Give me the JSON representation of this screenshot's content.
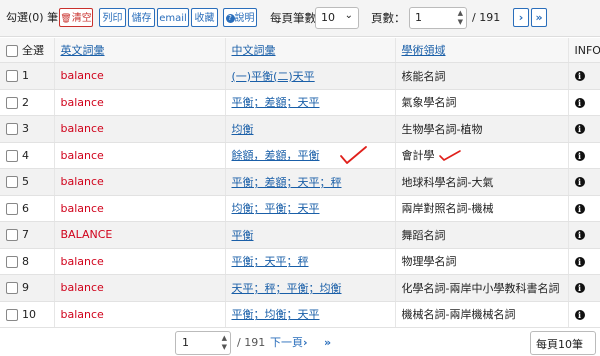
{
  "toolbar": {
    "selected_label": "勾選(",
    "selected_count": "0",
    "selected_suffix": ") 筆",
    "clear_label": "清空",
    "print_label": "列印",
    "save_label": "儲存",
    "email_label": "email",
    "collect_label": "收藏",
    "help_label": "說明",
    "per_page_label": "每頁筆數",
    "per_page_value": "10",
    "page_label": "頁數：",
    "page_value": "1",
    "page_total": "/ 191"
  },
  "table": {
    "headers": {
      "select_all": "全選",
      "english": "英文詞彙",
      "chinese": "中文詞彙",
      "field": "學術領域",
      "info": "INFO"
    },
    "rows": [
      {
        "num": "1",
        "en": "balance",
        "zh": "(一)平衡(二)天平",
        "field": "核能名詞"
      },
      {
        "num": "2",
        "en": "balance",
        "zh": "平衡；差額；天平",
        "field": "氣象學名詞"
      },
      {
        "num": "3",
        "en": "balance",
        "zh": "均衡",
        "field": "生物學名詞-植物"
      },
      {
        "num": "4",
        "en": "balance",
        "zh": "餘額，差額，平衡",
        "field": "會計學"
      },
      {
        "num": "5",
        "en": "balance",
        "zh": "平衡；差額；天平；秤",
        "field": "地球科學名詞-大氣"
      },
      {
        "num": "6",
        "en": "balance",
        "zh": "均衡；平衡；天平",
        "field": "兩岸對照名詞-機械"
      },
      {
        "num": "7",
        "en": "BALANCE",
        "zh": "平衡",
        "field": "舞蹈名詞"
      },
      {
        "num": "8",
        "en": "balance",
        "zh": "平衡；天平；秤",
        "field": "物理學名詞"
      },
      {
        "num": "9",
        "en": "balance",
        "zh": "天平；秤；平衡；均衡",
        "field": "化學名詞-兩岸中小學教科書名詞"
      },
      {
        "num": "10",
        "en": "balance",
        "zh": "平衡；均衡；天平",
        "field": "機械名詞-兩岸機械名詞"
      }
    ]
  },
  "pager": {
    "page_value": "1",
    "page_total": "/ 191",
    "next_label": "下一頁",
    "per_page_label": "每頁10筆"
  },
  "colors": {
    "accent": "#2a6ebb",
    "english_term": "#d0021b",
    "annotation": "#e0201b"
  }
}
